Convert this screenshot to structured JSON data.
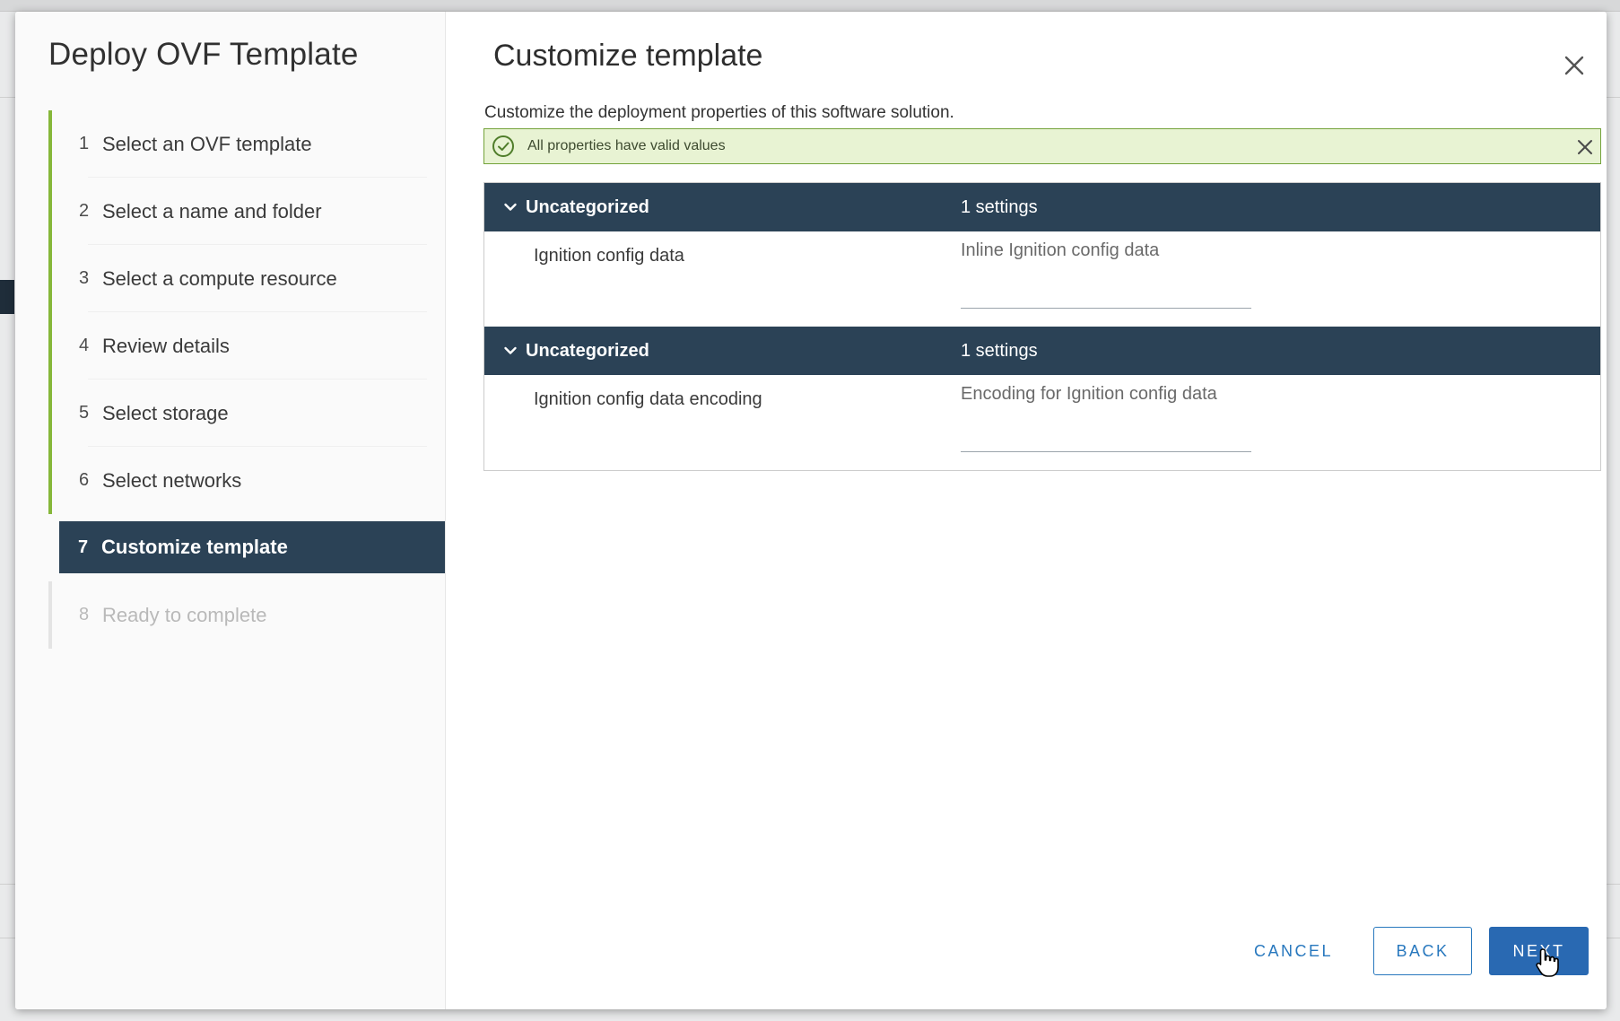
{
  "wizard": {
    "title": "Deploy OVF Template",
    "steps": [
      {
        "num": "1",
        "label": "Select an OVF template",
        "state": "done"
      },
      {
        "num": "2",
        "label": "Select a name and folder",
        "state": "done"
      },
      {
        "num": "3",
        "label": "Select a compute resource",
        "state": "done"
      },
      {
        "num": "4",
        "label": "Review details",
        "state": "done"
      },
      {
        "num": "5",
        "label": "Select storage",
        "state": "done"
      },
      {
        "num": "6",
        "label": "Select networks",
        "state": "done"
      },
      {
        "num": "7",
        "label": "Customize template",
        "state": "active"
      },
      {
        "num": "8",
        "label": "Ready to complete",
        "state": "pending"
      }
    ]
  },
  "page": {
    "title": "Customize template",
    "subtitle": "Customize the deployment properties of this software solution.",
    "close_icon": "close-icon"
  },
  "alert": {
    "message": "All properties have valid values",
    "icon": "check-circle-icon",
    "close_icon": "close-icon",
    "color": "#74a33b"
  },
  "groups": [
    {
      "name": "Uncategorized",
      "count": "1 settings",
      "property": {
        "label": "Ignition config data",
        "placeholder": "Inline Ignition config data",
        "value": ""
      }
    },
    {
      "name": "Uncategorized",
      "count": "1 settings",
      "property": {
        "label": "Ignition config data encoding",
        "placeholder": "Encoding for Ignition config data",
        "value": ""
      }
    }
  ],
  "footer": {
    "cancel": "CANCEL",
    "back": "BACK",
    "next": "NEXT"
  },
  "colors": {
    "header_bg": "#2b4256",
    "step_done_bar": "#86b73a",
    "primary": "#2969b2"
  }
}
